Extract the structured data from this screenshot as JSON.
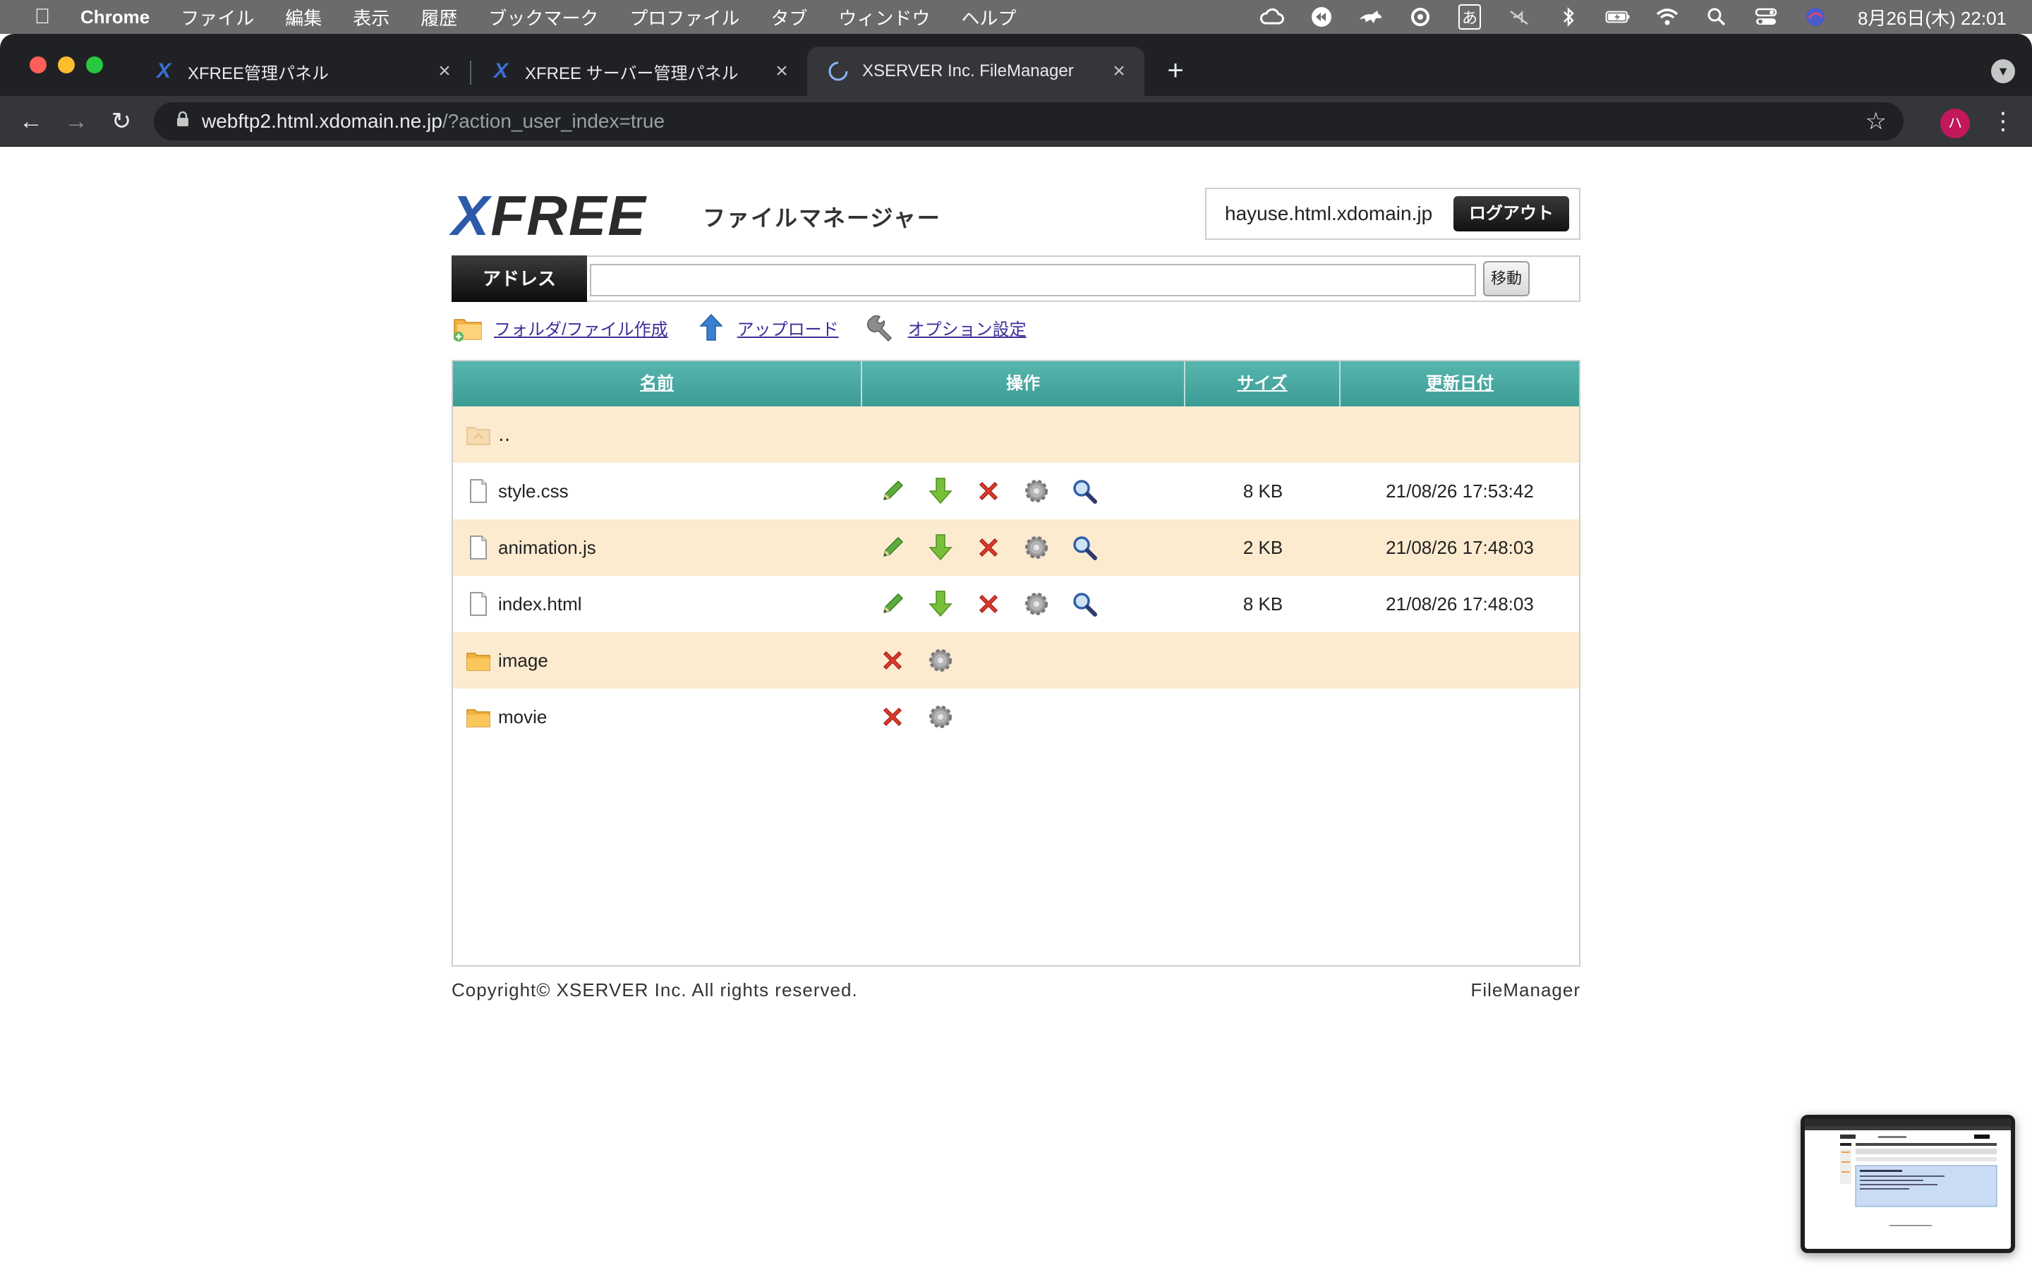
{
  "menubar": {
    "app_name": "Chrome",
    "items": [
      "ファイル",
      "編集",
      "表示",
      "履歴",
      "ブックマーク",
      "プロファイル",
      "タブ",
      "ウィンドウ",
      "ヘルプ"
    ],
    "input_method": "あ",
    "datetime": "8月26日(木)  22:01"
  },
  "browser": {
    "tabs": [
      {
        "title": "XFREE管理パネル",
        "icon": "xfree-x-icon"
      },
      {
        "title": "XFREE サーバー管理パネル",
        "icon": "xfree-x-icon"
      },
      {
        "title": "XSERVER Inc. FileManager",
        "icon": "loading-spinner-icon"
      }
    ],
    "active_tab": 2,
    "url_host": "webftp2.html.xdomain.ne.jp",
    "url_path": "/?action_user_index=true",
    "profile_initial": "ハ"
  },
  "header": {
    "logo_x": "X",
    "logo_rest": "FREE",
    "subtitle": "ファイルマネージャー",
    "user_host": "hayuse.html.xdomain.jp",
    "logout_label": "ログアウト"
  },
  "addressbar": {
    "label": "アドレス",
    "value": "",
    "go_label": "移動"
  },
  "actions": [
    {
      "label": "フォルダ/ファイル作成",
      "icon": "folder-create-icon"
    },
    {
      "label": "アップロード",
      "icon": "upload-icon"
    },
    {
      "label": "オプション設定",
      "icon": "wrench-icon"
    }
  ],
  "table": {
    "columns": [
      "名前",
      "操作",
      "サイズ",
      "更新日付"
    ],
    "parent_row": {
      "name": "‥"
    },
    "rows": [
      {
        "name": "style.css",
        "type": "file",
        "size": "8 KB",
        "date": "21/08/26 17:53:42"
      },
      {
        "name": "animation.js",
        "type": "file",
        "size": "2 KB",
        "date": "21/08/26 17:48:03"
      },
      {
        "name": "index.html",
        "type": "file",
        "size": "8 KB",
        "date": "21/08/26 17:48:03"
      },
      {
        "name": "image",
        "type": "folder",
        "size": "",
        "date": ""
      },
      {
        "name": "movie",
        "type": "folder",
        "size": "",
        "date": ""
      }
    ]
  },
  "footer": {
    "copyright": "Copyright© XSERVER Inc. All rights reserved.",
    "app": "FileManager"
  },
  "colors": {
    "header_teal": "#4aa9a2",
    "row_alt": "#fdebd0",
    "link": "#3a2f9a",
    "logo_blue": "#2d5aa8"
  }
}
